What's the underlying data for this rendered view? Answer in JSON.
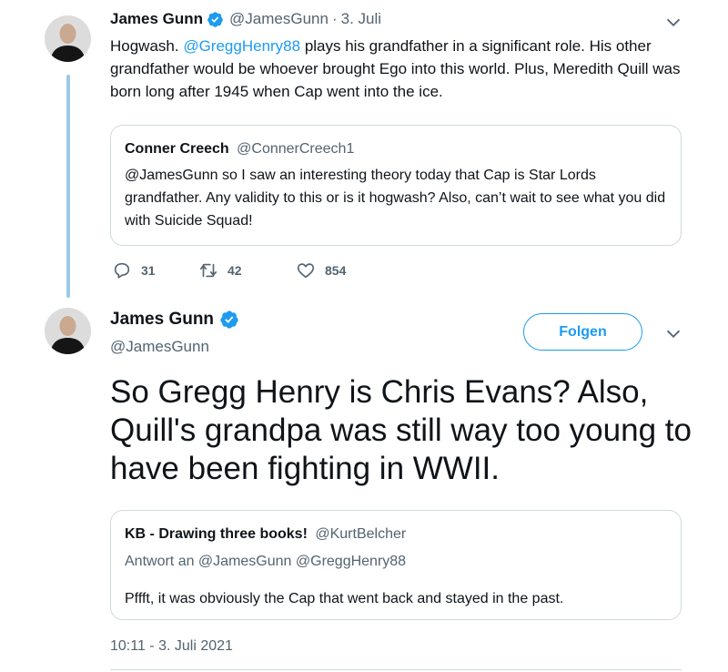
{
  "tweet1": {
    "author_name": "James Gunn",
    "author_handle": "@JamesGunn",
    "separator": "·",
    "date": "3. Juli",
    "text_parts": {
      "before_mention": "Hogwash. ",
      "mention": "@GreggHenry88",
      "after_mention": " plays his grandfather in a significant role. His other grandfather would be whoever brought Ego into this world. Plus, Meredith Quill was born long after 1945 when Cap went into the ice."
    },
    "quote": {
      "author_name": "Conner Creech",
      "author_handle": "@ConnerCreech1",
      "text": "@JamesGunn so I saw an interesting theory today that Cap is Star Lords grandfather. Any validity to this or is it hogwash? Also, can’t wait to see what you did with Suicide Squad!"
    },
    "stats": {
      "replies": "31",
      "retweets": "42",
      "likes": "854"
    }
  },
  "tweet2": {
    "author_name": "James Gunn",
    "author_handle": "@JamesGunn",
    "follow_label": "Folgen",
    "text": "So Gregg Henry is Chris Evans? Also, Quill's grandpa was still way too young to have been fighting in WWII.",
    "quote": {
      "author_name": "KB - Drawing three books!",
      "author_handle": "@KurtBelcher",
      "reply_to": "Antwort an @JamesGunn @GreggHenry88",
      "text": "Pffft, it was obviously the Cap that went back and stayed in the past."
    },
    "timestamp": "10:11 - 3. Juli 2021"
  },
  "colors": {
    "accent": "#1d9bf0",
    "thread_line": "#9cc9e8",
    "secondary_text": "#536471",
    "border": "#cfd9de"
  },
  "icons": [
    "verified-badge-icon",
    "chevron-down-icon",
    "reply-icon",
    "retweet-icon",
    "like-icon"
  ]
}
